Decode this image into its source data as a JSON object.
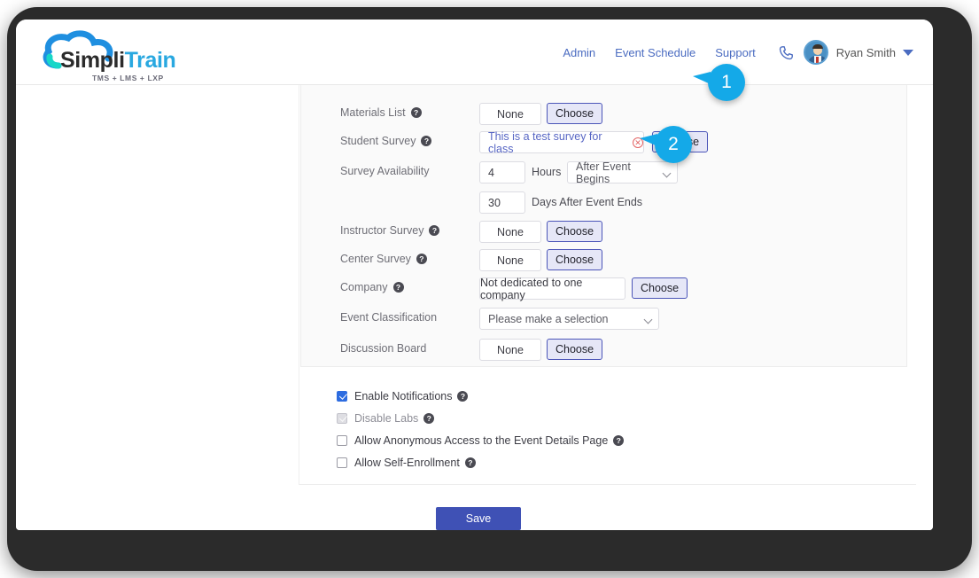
{
  "brand": {
    "name_part1": "Simpli",
    "name_part2": "Train",
    "tagline": "TMS + LMS + LXP",
    "cloud_color": "#1f8fe0",
    "accent_color": "#29a8e0"
  },
  "header": {
    "nav": [
      {
        "label": "Admin"
      },
      {
        "label": "Event Schedule"
      },
      {
        "label": "Support"
      }
    ],
    "phone_icon": "phone-icon",
    "avatar_icon": "user-avatar",
    "user_name": "Ryan Smith",
    "chevron": "chevron-down-icon"
  },
  "form": {
    "rows": [
      {
        "label": "Materials List",
        "help": true,
        "value": "None",
        "button": "Choose"
      },
      {
        "label": "Student Survey",
        "help": true,
        "value": "This is a test survey for class",
        "button": "Choose",
        "clearable": true
      },
      {
        "label": "Survey Availability",
        "help": false
      },
      {
        "label": "Instructor Survey",
        "help": true,
        "value": "None",
        "button": "Choose"
      },
      {
        "label": "Center Survey",
        "help": true,
        "value": "None",
        "button": "Choose"
      },
      {
        "label": "Company",
        "help": true,
        "value": "Not dedicated to one company",
        "button": "Choose"
      },
      {
        "label": "Event Classification",
        "help": false,
        "value": "Please make a selection"
      },
      {
        "label": "Discussion Board",
        "help": false,
        "value": "None",
        "button": "Choose"
      }
    ],
    "availability": {
      "hours_value": "4",
      "hours_label": "Hours",
      "hours_select": "After Event Begins",
      "days_value": "30",
      "days_label": "Days After Event Ends"
    }
  },
  "checkboxes": [
    {
      "label": "Enable Notifications",
      "checked": true,
      "disabled": false,
      "help": true
    },
    {
      "label": "Disable Labs",
      "checked": true,
      "disabled": true,
      "help": true
    },
    {
      "label": "Allow Anonymous Access to the Event Details Page",
      "checked": false,
      "disabled": false,
      "help": true
    },
    {
      "label": "Allow Self-Enrollment",
      "checked": false,
      "disabled": false,
      "help": true
    }
  ],
  "actions": {
    "save_label": "Save",
    "save_color": "#3f51b5"
  },
  "callouts": [
    {
      "number": "1",
      "color": "#14a9e8"
    },
    {
      "number": "2",
      "color": "#14a9e8"
    }
  ]
}
